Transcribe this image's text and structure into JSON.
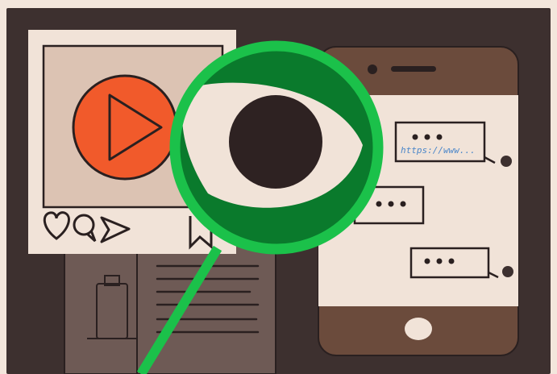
{
  "illustration": {
    "chat": {
      "link_text": "https://www..."
    },
    "colors": {
      "background": "#3d302f",
      "paper": "#f1e3d8",
      "play_button": "#f15a2b",
      "lens_ring": "#1bc14a",
      "lens_fill": "#0a7a2c",
      "phone_body": "#6b4b3c",
      "phone_screen": "#f1e3d8",
      "link_blue": "#4a86c9"
    },
    "icons": [
      "play-icon",
      "heart-icon",
      "comment-icon",
      "share-icon",
      "bookmark-icon",
      "eye-icon",
      "magnifier-icon",
      "luggage-icon"
    ]
  }
}
